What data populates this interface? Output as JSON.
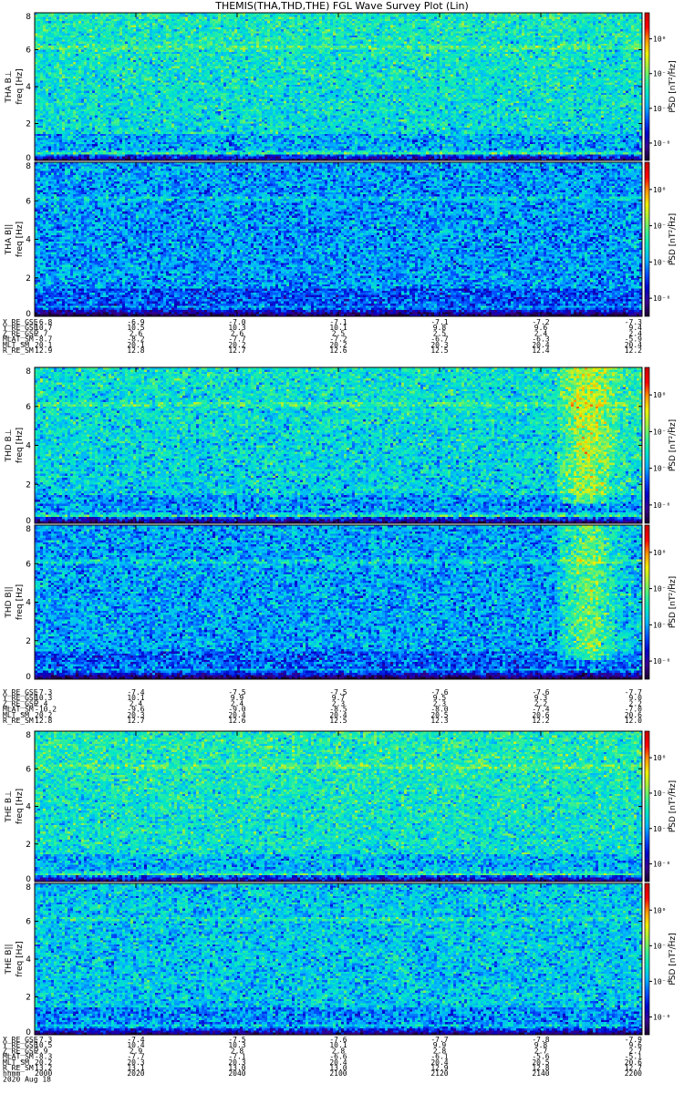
{
  "title": "THEMIS(THA,THD,THE) FGL Wave Survey Plot (Lin)",
  "colorbar": {
    "label": "PSD [nT²/Hz]",
    "ticks": [
      "10⁰",
      "10⁻²",
      "10⁻⁴",
      "10⁻⁶"
    ],
    "tick_exponents": [
      0,
      -2,
      -4,
      -6
    ],
    "log_range": [
      -7,
      1.5
    ],
    "colormap": [
      "#1a0030",
      "#3a0090",
      "#0000c8",
      "#0050ff",
      "#00b4ff",
      "#00e6c8",
      "#3cf08c",
      "#a0f040",
      "#f0f000",
      "#ff9600",
      "#ff0000",
      "#c80000"
    ]
  },
  "chart_data": [
    {
      "type": "heatmap",
      "probe": "THA",
      "panels": [
        {
          "name": "THA B⊥",
          "ylabel": "freq [Hz]",
          "ylim": [
            0,
            8
          ],
          "yticks": [
            0,
            2,
            4,
            6,
            8
          ],
          "mean_log_psd": -3.4
        },
        {
          "name": "THA B||",
          "ylabel": "freq [Hz]",
          "ylim": [
            0,
            8
          ],
          "yticks": [
            0,
            2,
            4,
            6,
            8
          ],
          "mean_log_psd": -4.1
        }
      ],
      "ephemeris": [
        {
          "label": "X_RE_GSE",
          "values": [
            "-6.8",
            "-6.9",
            "-7.0",
            "-7.1",
            "-7.1",
            "-7.2",
            "-7.3"
          ]
        },
        {
          "label": "Y_RE_GSE",
          "values": [
            "10.7",
            "10.5",
            "10.3",
            "10.1",
            "9.8",
            "9.6",
            "9.4"
          ]
        },
        {
          "label": "Z_RE_GSE",
          "values": [
            "2.7",
            "2.6",
            "2.6",
            "2.5",
            "2.5",
            "2.4",
            "2.4"
          ]
        },
        {
          "label": "MLAT_SM",
          "values": [
            "-8.7",
            "-8.2",
            "-7.7",
            "-7.2",
            "-6.7",
            "-6.3",
            "-5.9"
          ]
        },
        {
          "label": "MLT_SM",
          "values": [
            "20.1",
            "20.1",
            "20.2",
            "20.2",
            "20.3",
            "20.4",
            "20.4"
          ]
        },
        {
          "label": "R_RE_SM",
          "values": [
            "12.9",
            "12.8",
            "12.7",
            "12.6",
            "12.5",
            "12.4",
            "12.2"
          ]
        }
      ]
    },
    {
      "type": "heatmap",
      "probe": "THD",
      "panels": [
        {
          "name": "THD B⊥",
          "ylabel": "freq [Hz]",
          "ylim": [
            0,
            8
          ],
          "yticks": [
            0,
            2,
            4,
            6,
            8
          ],
          "mean_log_psd": -3.6
        },
        {
          "name": "THD B||",
          "ylabel": "freq [Hz]",
          "ylim": [
            0,
            8
          ],
          "yticks": [
            0,
            2,
            4,
            6,
            8
          ],
          "mean_log_psd": -4.0
        }
      ],
      "ephemeris": [
        {
          "label": "X_RE_GSE",
          "values": [
            "-7.3",
            "-7.4",
            "-7.5",
            "-7.5",
            "-7.6",
            "-7.6",
            "-7.7"
          ]
        },
        {
          "label": "Y_RE_GSE",
          "values": [
            "10.3",
            "10.1",
            "9.9",
            "9.7",
            "9.5",
            "9.3",
            "9.0"
          ]
        },
        {
          "label": "Z_RE_GSE",
          "values": [
            "2.4",
            "2.4",
            "2.4",
            "2.3",
            "2.3",
            "2.2",
            "2.2"
          ]
        },
        {
          "label": "MLAT_SM",
          "values": [
            "-10.2",
            "-9.6",
            "-9.0",
            "-8.5",
            "-8.0",
            "-7.4",
            "-7.0"
          ]
        },
        {
          "label": "MLT_SM",
          "values": [
            "20.2",
            "20.3",
            "20.4",
            "20.4",
            "20.5",
            "20.6",
            "20.6"
          ]
        },
        {
          "label": "R_RE_SM",
          "values": [
            "12.8",
            "12.7",
            "12.6",
            "12.5",
            "12.3",
            "12.2",
            "12.0"
          ]
        }
      ]
    },
    {
      "type": "heatmap",
      "probe": "THE",
      "panels": [
        {
          "name": "THE B⊥",
          "ylabel": "freq [Hz]",
          "ylim": [
            0,
            8
          ],
          "yticks": [
            0,
            2,
            4,
            6,
            8
          ],
          "mean_log_psd": -3.3
        },
        {
          "name": "THE B||",
          "ylabel": "freq [Hz]",
          "ylim": [
            0,
            8
          ],
          "yticks": [
            0,
            2,
            4,
            6,
            8
          ],
          "mean_log_psd": -3.6
        }
      ],
      "ephemeris": [
        {
          "label": "X_RE_GSE",
          "values": [
            "-7.3",
            "-7.4",
            "-7.5",
            "-7.6",
            "-7.7",
            "-7.8",
            "-7.9"
          ]
        },
        {
          "label": "Y_RE_GSE",
          "values": [
            "10.5",
            "10.4",
            "10.3",
            "10.1",
            "9.9",
            "9.8",
            "9.6"
          ]
        },
        {
          "label": "Z_RE_GSE",
          "values": [
            "2.9",
            "2.9",
            "2.8",
            "2.8",
            "2.8",
            "2.7",
            "2.7"
          ]
        },
        {
          "label": "MLAT_SM",
          "values": [
            "-8.3",
            "-7.7",
            "-7.1",
            "-6.6",
            "-6.1",
            "-5.6",
            "-5.1"
          ]
        },
        {
          "label": "MLT_SM",
          "values": [
            "20.2",
            "20.3",
            "20.3",
            "20.4",
            "20.4",
            "20.5",
            "20.6"
          ]
        },
        {
          "label": "R_RE_SM",
          "values": [
            "13.2",
            "13.1",
            "13.0",
            "13.0",
            "12.9",
            "12.8",
            "12.7"
          ]
        },
        {
          "label": "hhmm",
          "values": [
            "2000",
            "2020",
            "2040",
            "2100",
            "2120",
            "2140",
            "2200"
          ]
        }
      ],
      "date": "2020 Aug 18"
    }
  ]
}
